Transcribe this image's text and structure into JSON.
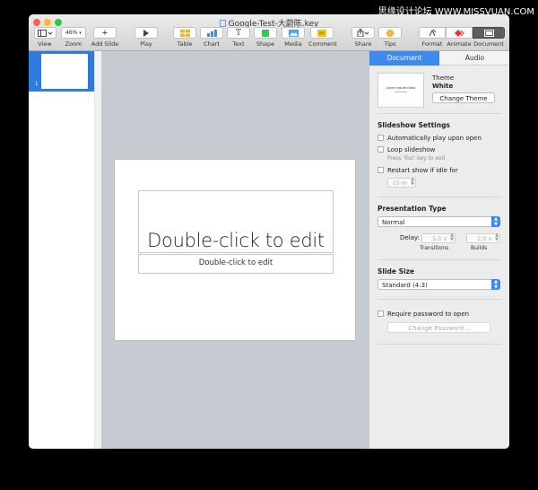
{
  "watermark": "思缘设计论坛 WWW.MISSVUAN.COM",
  "window": {
    "title": "Google-Test-大蔚陈.key"
  },
  "toolbar": {
    "view": {
      "label": "View",
      "icon": "sidebar-layout-icon"
    },
    "zoom": {
      "label": "Zoom",
      "value": "46%"
    },
    "add_slide": {
      "label": "Add Slide",
      "icon": "plus-icon"
    },
    "play": {
      "label": "Play",
      "icon": "play-icon"
    },
    "table": {
      "label": "Table",
      "icon": "table-icon"
    },
    "chart": {
      "label": "Chart",
      "icon": "chart-icon"
    },
    "text": {
      "label": "Text",
      "icon": "text-icon"
    },
    "shape": {
      "label": "Shape",
      "icon": "shape-icon"
    },
    "media": {
      "label": "Media",
      "icon": "media-icon"
    },
    "comment": {
      "label": "Comment",
      "icon": "comment-icon"
    },
    "share": {
      "label": "Share",
      "icon": "share-icon"
    },
    "tips": {
      "label": "Tips",
      "icon": "tips-icon"
    },
    "format": {
      "label": "Format",
      "icon": "paintbrush-icon"
    },
    "animate": {
      "label": "Animate",
      "icon": "animate-diamond-icon"
    },
    "document": {
      "label": "Document",
      "icon": "document-icon"
    }
  },
  "navigator": {
    "slides": [
      {
        "number": "1"
      }
    ]
  },
  "slide": {
    "title_placeholder": "Double-click to edit",
    "subtitle_placeholder": "Double-click to edit"
  },
  "inspector": {
    "tabs": {
      "document": "Document",
      "audio": "Audio"
    },
    "theme": {
      "thumbnail_text": "Lorem Ipsum Dolor",
      "label": "Theme",
      "name": "White",
      "change_button": "Change Theme"
    },
    "slideshow_settings": {
      "heading": "Slideshow Settings",
      "autoplay_label": "Automatically play upon open",
      "loop_label": "Loop slideshow",
      "loop_hint": "Press 'Esc' key to exit",
      "restart_label": "Restart show if idle for",
      "idle_value": "15 m"
    },
    "presentation_type": {
      "heading": "Presentation Type",
      "selected": "Normal",
      "delay_label": "Delay:",
      "transitions_value": "5.0 s",
      "transitions_label": "Transitions",
      "builds_value": "2.0 s",
      "builds_label": "Builds"
    },
    "slide_size": {
      "heading": "Slide Size",
      "selected": "Standard (4:3)"
    },
    "password": {
      "require_label": "Require password to open",
      "change_button": "Change Password..."
    }
  },
  "colors": {
    "accent": "#2e7be2",
    "close": "#fc5f57",
    "minimize": "#fdbb2e",
    "maximize": "#33c748",
    "canvas": "#c6cbd2"
  }
}
